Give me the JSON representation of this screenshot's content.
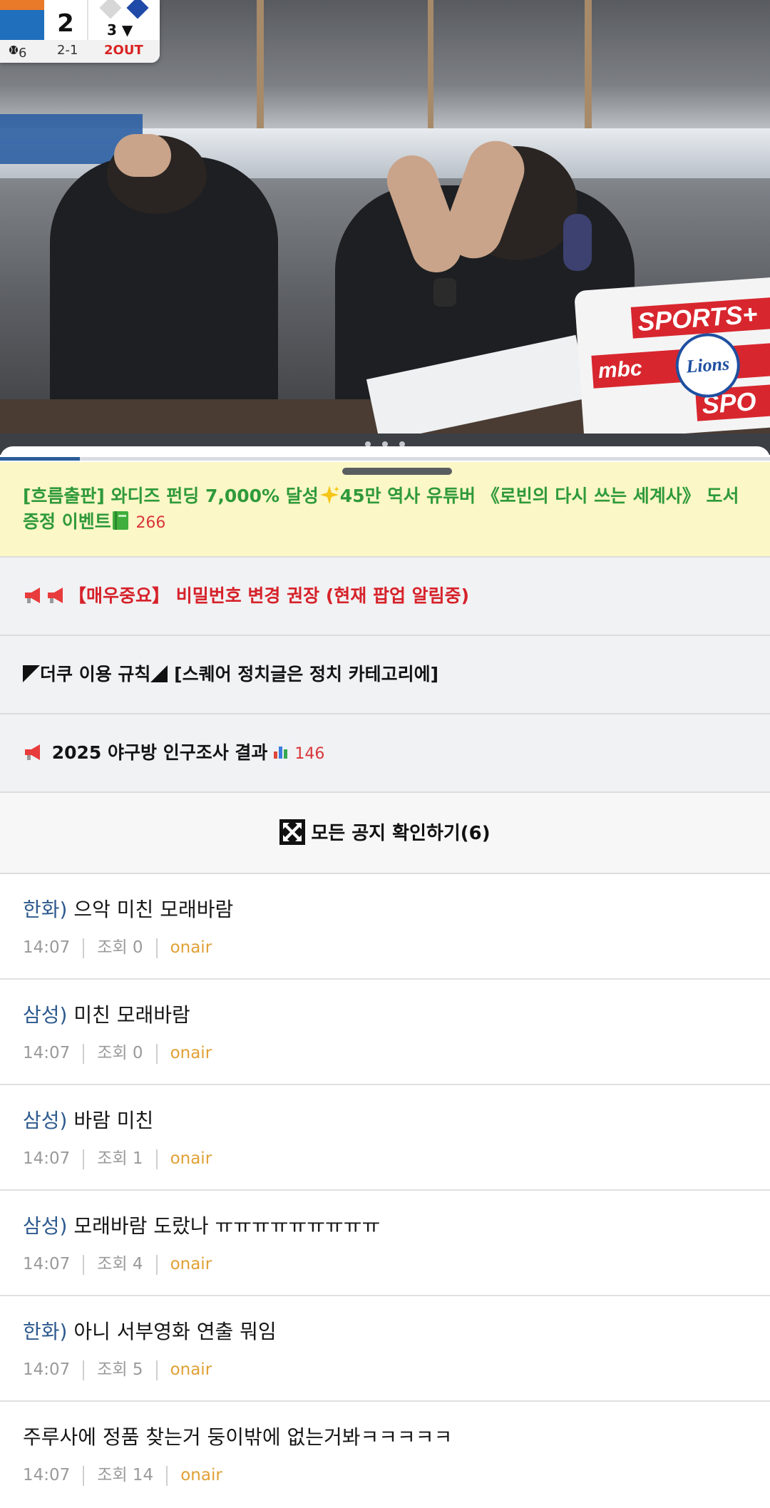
{
  "scoreboard": {
    "score": "2",
    "inning": "3 ▼",
    "pitch_count": "6",
    "ball_strike": "2-1",
    "outs": "2OUT"
  },
  "video": {
    "laptop_banner_1": "SPORTS+",
    "laptop_banner_2": "mbc",
    "laptop_banner_3": "SPO",
    "logo_text": "Lions"
  },
  "notices": {
    "event": {
      "text": "[흐름출판] 와디즈 펀딩 7,000% 달성",
      "text_2": "45만 역사 유튜버 《로빈의 다시 쓰는 세계사》 도서 증정 이벤트",
      "comments": "266"
    },
    "important": {
      "text": "【매우중요】 비밀번호 변경 권장 (현재 팝업 알림중)"
    },
    "rules": {
      "text": "더쿠 이용 규칙",
      "text_2": "[스퀘어 정치글은 정치 카테고리에]"
    },
    "census": {
      "text": "2025 야구방 인구조사 결과",
      "comments": "146"
    },
    "all_label": "모든 공지 확인하기(6)"
  },
  "posts": [
    {
      "tag": "한화)",
      "title": "으악 미친 모래바람",
      "time": "14:07",
      "views": "조회 0",
      "category": "onair"
    },
    {
      "tag": "삼성)",
      "title": "미친 모래바람",
      "time": "14:07",
      "views": "조회 0",
      "category": "onair"
    },
    {
      "tag": "삼성)",
      "title": "바람 미친",
      "time": "14:07",
      "views": "조회 1",
      "category": "onair"
    },
    {
      "tag": "삼성)",
      "title": "모래바람 도랐나 ㅠㅠㅠㅠㅠㅠㅠㅠㅠ",
      "time": "14:07",
      "views": "조회 4",
      "category": "onair"
    },
    {
      "tag": "한화)",
      "title": "아니 서부영화 연출 뭐임",
      "time": "14:07",
      "views": "조회 5",
      "category": "onair"
    },
    {
      "tag": "",
      "title": "주루사에 정품 찾는거 둥이밖에 없는거봐ㅋㅋㅋㅋㅋ",
      "time": "14:07",
      "views": "조회 14",
      "category": "onair"
    }
  ],
  "colors": {
    "accent": "#2b5d99",
    "event_text": "#2f9a3b",
    "important_text": "#d6222a",
    "comment_count": "#d9363a",
    "category": "#e0a035"
  },
  "icons": [
    "megaphone-icon",
    "sparkle-icon",
    "book-icon",
    "corner-triangle-icon",
    "bar-chart-icon",
    "expand-arrows-icon",
    "baseball-icon"
  ]
}
